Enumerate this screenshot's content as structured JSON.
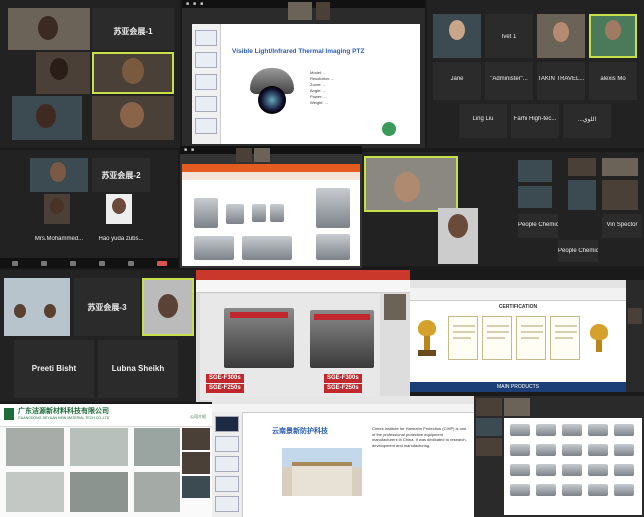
{
  "meeting_grid_1": {
    "tiles": [
      {
        "name": ""
      },
      {
        "name": "苏亚会展-1"
      },
      {
        "name": ""
      },
      {
        "name": ""
      },
      {
        "name": ""
      },
      {
        "name": ""
      }
    ]
  },
  "ptz_slide": {
    "title": "Visible Light/Infrared Thermal Imaging PTZ",
    "specs": [
      "Model: ...",
      "Resolution: ...",
      "Zoom: ...",
      "Angle: ...",
      "Power: ...",
      "Weight: ..."
    ]
  },
  "meeting_grid_2": {
    "tiles": [
      {
        "name": "Jane"
      },
      {
        "name": "\"Administer\"..."
      },
      {
        "name": "TAKIN TRAVEL..."
      },
      {
        "name": "alexis Mo"
      },
      {
        "name": "Ling Liu"
      },
      {
        "name": "Farhi High-tec..."
      },
      {
        "name": "...اللوي"
      },
      {
        "name": ""
      }
    ]
  },
  "meeting_grid_3": {
    "tiles": [
      {
        "name": "苏亚会展-2"
      },
      {
        "name": "Mrs.Mohammed..."
      },
      {
        "name": "Hao yuda zubs..."
      }
    ]
  },
  "meeting_grid_4": {
    "tiles": [
      {
        "name": "People Chemic..."
      },
      {
        "name": "Vin Spector"
      },
      {
        "name": "People Chemic..."
      }
    ]
  },
  "meeting_grid_5": {
    "tiles": [
      {
        "name": "苏亚会展-3"
      },
      {
        "name": "Preeti Bisht"
      },
      {
        "name": "Lubna Sheikh"
      }
    ]
  },
  "machine_slide": {
    "labels": [
      "SGE-F300s",
      "SGE-F250s",
      "SGE-F300s",
      "SGE-F250s"
    ]
  },
  "cert_slide": {
    "title": "CERTIFICATION",
    "footer": "MAIN PRODUCTS"
  },
  "company_site": {
    "name": "广东洁源新材料科技有限公司",
    "name_en": "GUANGDONG JIEYUAN NEW MATERIAL TECH CO.,LTD",
    "nav": "公司介绍"
  },
  "intro_slide": {
    "company": "云南景新防护科技",
    "body": "Chees Institute for Harmahn Protection (CIHP) is one of the professional protective equipment manufacturers in China. It was dedicated to research, development and manufacturing."
  }
}
